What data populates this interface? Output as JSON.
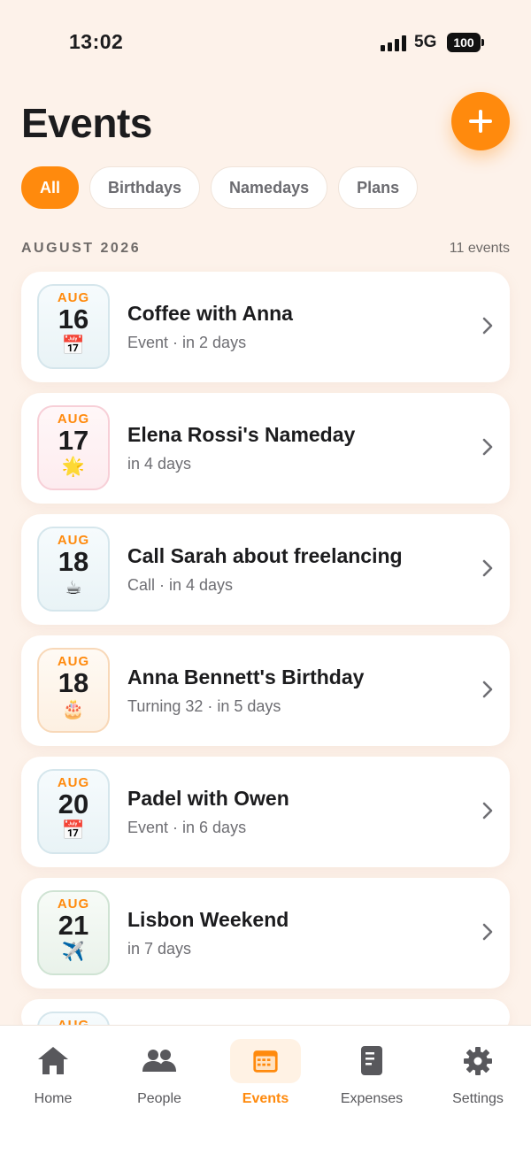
{
  "status": {
    "time": "13:02",
    "network": "5G",
    "battery": "100"
  },
  "header": {
    "title": "Events",
    "add_icon": "plus-icon"
  },
  "filters": [
    {
      "label": "All",
      "active": true
    },
    {
      "label": "Birthdays",
      "active": false
    },
    {
      "label": "Namedays",
      "active": false
    },
    {
      "label": "Plans",
      "active": false
    }
  ],
  "section": {
    "title": "AUGUST 2026",
    "count": "11 events"
  },
  "events": [
    {
      "month": "AUG",
      "day": "16",
      "emoji": "📅",
      "title": "Coffee with Anna",
      "subtitle": "Event · in 2 days"
    },
    {
      "month": "AUG",
      "day": "17",
      "emoji": "🌟",
      "title": "Elena Rossi's Nameday",
      "subtitle": "in 4 days"
    },
    {
      "month": "AUG",
      "day": "18",
      "emoji": "☕",
      "title": "Call Sarah about freelancing",
      "subtitle": "Call · in 4 days"
    },
    {
      "month": "AUG",
      "day": "18",
      "emoji": "🎂",
      "title": "Anna Bennett's Birthday",
      "subtitle": "Turning 32 · in 5 days"
    },
    {
      "month": "AUG",
      "day": "20",
      "emoji": "📅",
      "title": "Padel with Owen",
      "subtitle": "Event · in 6 days"
    },
    {
      "month": "AUG",
      "day": "21",
      "emoji": "✈️",
      "title": "Lisbon Weekend",
      "subtitle": "in 7 days"
    },
    {
      "month": "AUG",
      "day": "",
      "emoji": "",
      "title": "",
      "subtitle": ""
    }
  ],
  "tabs": [
    {
      "label": "Home",
      "icon": "home-icon"
    },
    {
      "label": "People",
      "icon": "people-icon"
    },
    {
      "label": "Events",
      "icon": "calendar-icon",
      "active": true
    },
    {
      "label": "Expenses",
      "icon": "receipt-icon"
    },
    {
      "label": "Settings",
      "icon": "gear-icon"
    }
  ],
  "colors": {
    "accent": "#ff8a0d",
    "background": "#fdf2ea"
  }
}
